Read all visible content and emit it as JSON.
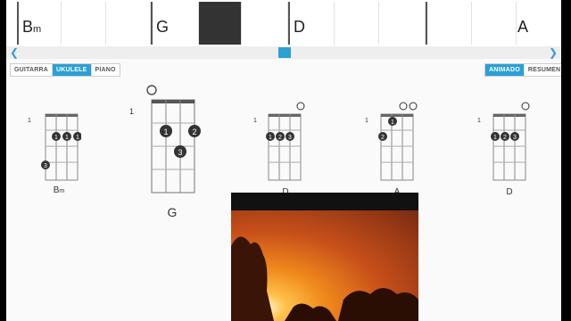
{
  "timeline": {
    "chords": [
      {
        "root": "B",
        "suffix": "m"
      },
      {
        "root": "G",
        "suffix": ""
      },
      {
        "root": "D",
        "suffix": ""
      },
      {
        "root": "A",
        "suffix": ""
      }
    ]
  },
  "scroll": {
    "left_icon": "chevron-left-icon",
    "right_icon": "chevron-right-icon",
    "position": 0.49
  },
  "instrument_tabs": [
    "GUITARRA",
    "UKULELE",
    "PIANO"
  ],
  "instrument_selected": "UKULELE",
  "view_tabs": [
    "ANIMADO",
    "RESUMEN"
  ],
  "view_selected": "ANIMADO",
  "diagrams": [
    {
      "name": "B",
      "suffix": "m",
      "fret": "1"
    },
    {
      "name": "G",
      "suffix": "",
      "fret": "1"
    },
    {
      "name": "D",
      "suffix": "",
      "fret": "1"
    },
    {
      "name": "A",
      "suffix": "",
      "fret": "1"
    },
    {
      "name": "D",
      "suffix": "",
      "fret": "1"
    }
  ],
  "colors": {
    "accent": "#2aa0d4",
    "active_beat": "#333333"
  }
}
